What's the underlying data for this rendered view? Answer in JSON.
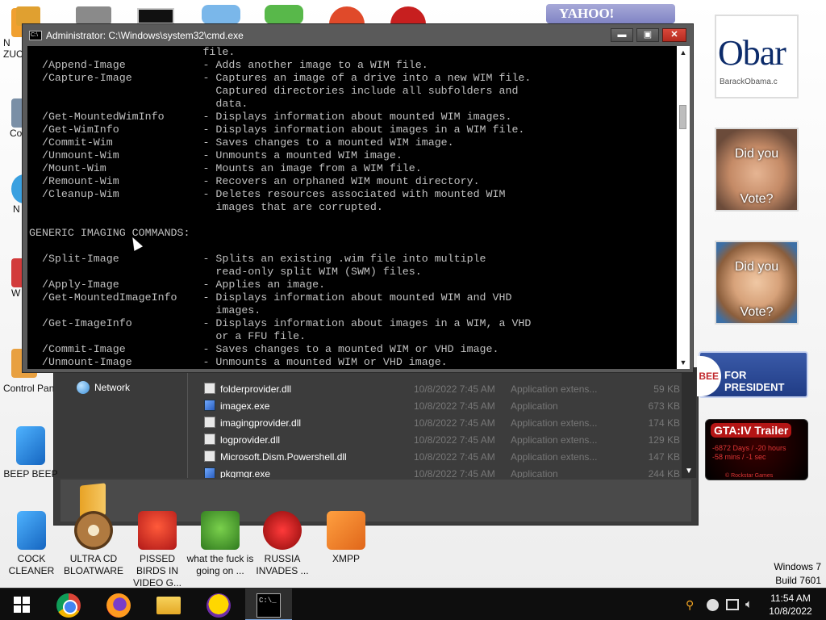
{
  "cmd": {
    "title": "Administrator: C:\\Windows\\system32\\cmd.exe",
    "window_buttons": {
      "minimize": "▬",
      "maximize": "▣",
      "close": "✕"
    },
    "text": "                           file.\n  /Append-Image            - Adds another image to a WIM file.\n  /Capture-Image           - Captures an image of a drive into a new WIM file.\n                             Captured directories include all subfolders and\n                             data.\n  /Get-MountedWimInfo      - Displays information about mounted WIM images.\n  /Get-WimInfo             - Displays information about images in a WIM file.\n  /Commit-Wim              - Saves changes to a mounted WIM image.\n  /Unmount-Wim             - Unmounts a mounted WIM image.\n  /Mount-Wim               - Mounts an image from a WIM file.\n  /Remount-Wim             - Recovers an orphaned WIM mount directory.\n  /Cleanup-Wim             - Deletes resources associated with mounted WIM\n                             images that are corrupted.\n\nGENERIC IMAGING COMMANDS:\n\n  /Split-Image             - Splits an existing .wim file into multiple\n                             read-only split WIM (SWM) files.\n  /Apply-Image             - Applies an image.\n  /Get-MountedImageInfo    - Displays information about mounted WIM and VHD\n                             images.\n  /Get-ImageInfo           - Displays information about images in a WIM, a VHD\n                             or a FFU file.\n  /Commit-Image            - Saves changes to a mounted WIM or VHD image.\n  /Unmount-Image           - Unmounts a mounted WIM or VHD image."
  },
  "explorer": {
    "nav_item": "Network",
    "files": [
      {
        "name": "folderprovider.dll",
        "date": "10/8/2022 7:45 AM",
        "type": "Application extens...",
        "size": "59 KB",
        "icon": "dll-file-icon"
      },
      {
        "name": "imagex.exe",
        "date": "10/8/2022 7:45 AM",
        "type": "Application",
        "size": "673 KB",
        "icon": "exe-file-icon"
      },
      {
        "name": "imagingprovider.dll",
        "date": "10/8/2022 7:45 AM",
        "type": "Application extens...",
        "size": "174 KB",
        "icon": "dll-file-icon"
      },
      {
        "name": "logprovider.dll",
        "date": "10/8/2022 7:45 AM",
        "type": "Application extens...",
        "size": "129 KB",
        "icon": "dll-file-icon"
      },
      {
        "name": "Microsoft.Dism.Powershell.dll",
        "date": "10/8/2022 7:45 AM",
        "type": "Application extens...",
        "size": "147 KB",
        "icon": "dll-file-icon"
      },
      {
        "name": "pkgmgr.exe",
        "date": "10/8/2022 7:45 AM",
        "type": "Application",
        "size": "244 KB",
        "icon": "exe-file-icon"
      }
    ]
  },
  "desktop": {
    "left_partial_labels": [
      "N\nZUC",
      "Co",
      "N",
      "W",
      "Control Pan"
    ],
    "icons": [
      {
        "label": "BEEP BEEP",
        "color": "#1e88e5"
      },
      {
        "label": "COCK CLEANER",
        "color": "#1e88e5"
      },
      {
        "label": "ULTRA CD BLOATWARE",
        "color": "#9b6b3a"
      },
      {
        "label": "PISSED BIRDS IN VIDEO G...",
        "color": "#d83b3b"
      },
      {
        "label": "what the fuck is going on ...",
        "color": "#5aa83a"
      },
      {
        "label": "RUSSIA INVADES ...",
        "color": "#c62828"
      },
      {
        "label": "XMPP",
        "color": "#f08a24"
      }
    ]
  },
  "gadgets": {
    "yahoo": "YAHOO!",
    "obama_big": "Obar",
    "obama_small": "BarackObama.c",
    "mccain_q1": "Did you",
    "mccain_q2": "Vote?",
    "hillary_q1": "Did you",
    "hillary_q2": "Vote?",
    "president_logo": "BEE",
    "president_text": "FOR PRESIDENT",
    "gta_title": "GTA:IV Trailer",
    "gta_days": "-6872 Days / -20 hours",
    "gta_mins": "-58 mins / -1 sec",
    "gta_studio": "© Rockstar Games"
  },
  "watermark": {
    "line1": "Windows 7",
    "line2": "Build 7601"
  },
  "taskbar": {
    "buttons": [
      "start-button",
      "chrome-button",
      "firefox-button",
      "file-explorer-button",
      "yahoo-messenger-button",
      "cmd-button"
    ],
    "cmd_glyph": "C:\\_",
    "time": "11:54 AM",
    "date": "10/8/2022",
    "tray_icons": [
      "search-icon",
      "gauge-icon",
      "network-icon",
      "volume-icon"
    ]
  }
}
